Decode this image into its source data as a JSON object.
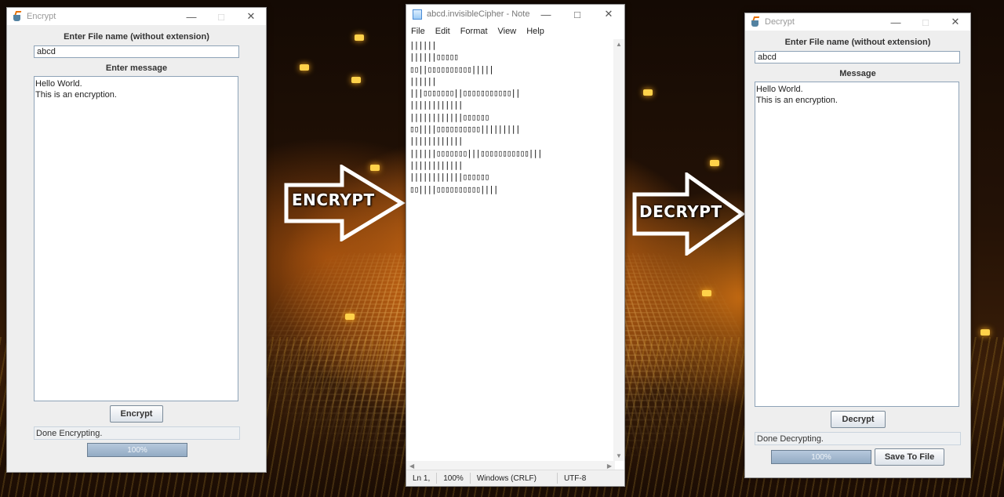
{
  "encrypt_window": {
    "title": "Encrypt",
    "filename_label": "Enter File name (without extension)",
    "filename_value": "abcd",
    "message_label": "Enter message",
    "message_lines": [
      "Hello World.",
      "This is an encryption."
    ],
    "action_button": "Encrypt",
    "status": "Done Encrypting.",
    "progress": "100%"
  },
  "notepad": {
    "title": "abcd.invisibleCipher - Note...",
    "menu": [
      "File",
      "Edit",
      "Format",
      "View",
      "Help"
    ],
    "lines": [
      "||||||",
      "||||||▯▯▯▯▯",
      "▯▯||▯▯▯▯▯▯▯▯▯▯|||||",
      "||||||",
      "|||▯▯▯▯▯▯▯||▯▯▯▯▯▯▯▯▯▯▯||",
      "||||||||||||",
      "||||||||||||▯▯▯▯▯▯",
      "▯▯||||▯▯▯▯▯▯▯▯▯▯|||||||||",
      "||||||||||||",
      "||||||▯▯▯▯▯▯▯|||▯▯▯▯▯▯▯▯▯▯▯|||",
      "||||||||||||",
      "||||||||||||▯▯▯▯▯▯",
      "▯▯||||▯▯▯▯▯▯▯▯▯▯||||"
    ],
    "status": {
      "position": "Ln 1,",
      "zoom": "100%",
      "line_ending": "Windows (CRLF)",
      "encoding": "UTF-8"
    }
  },
  "decrypt_window": {
    "title": "Decrypt",
    "filename_label": "Enter File name (without extension)",
    "filename_value": "abcd",
    "message_label": "Message",
    "message_lines": [
      "Hello World.",
      "This is an encryption."
    ],
    "action_button": "Decrypt",
    "status": "Done Decrypting.",
    "progress": "100%",
    "save_button": "Save To File"
  },
  "arrows": {
    "encrypt": "ENCRYPT",
    "decrypt": "DECRYPT"
  },
  "colors": {
    "arrow_stroke": "#ffffff",
    "progress_fill": "#a3b8ce",
    "window_bg": "#eeeeee",
    "field_border": "#8ea3b7"
  }
}
